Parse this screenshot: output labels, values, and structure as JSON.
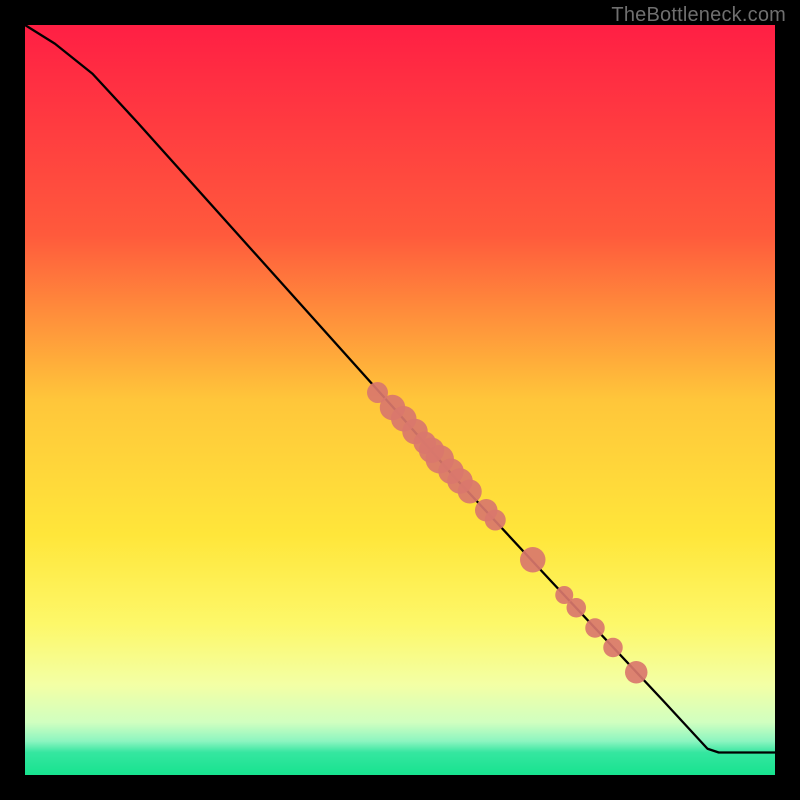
{
  "watermark": "TheBottleneck.com",
  "chart_data": {
    "type": "line",
    "title": "",
    "xlabel": "",
    "ylabel": "",
    "xlim": [
      0,
      100
    ],
    "ylim": [
      0,
      100
    ],
    "gradient_stops": [
      {
        "offset": 0,
        "color": "#ff1f44"
      },
      {
        "offset": 28,
        "color": "#ff5a3c"
      },
      {
        "offset": 50,
        "color": "#ffc63a"
      },
      {
        "offset": 68,
        "color": "#ffe63a"
      },
      {
        "offset": 80,
        "color": "#fdf86a"
      },
      {
        "offset": 88,
        "color": "#f3ffa5"
      },
      {
        "offset": 93,
        "color": "#d0ffc0"
      },
      {
        "offset": 95.5,
        "color": "#8cf5c0"
      },
      {
        "offset": 97,
        "color": "#35e6a0"
      },
      {
        "offset": 100,
        "color": "#17e38f"
      }
    ],
    "curve": [
      {
        "x": 0,
        "y": 100
      },
      {
        "x": 4,
        "y": 97.5
      },
      {
        "x": 9,
        "y": 93.5
      },
      {
        "x": 15,
        "y": 87
      },
      {
        "x": 50,
        "y": 48
      },
      {
        "x": 57,
        "y": 40
      },
      {
        "x": 70,
        "y": 26
      },
      {
        "x": 85,
        "y": 10
      },
      {
        "x": 91,
        "y": 3.5
      },
      {
        "x": 92.5,
        "y": 3
      },
      {
        "x": 100,
        "y": 3
      }
    ],
    "series": [
      {
        "name": "markers",
        "points": [
          {
            "x": 47,
            "y": 51,
            "r": 1.4
          },
          {
            "x": 49,
            "y": 49,
            "r": 1.7
          },
          {
            "x": 50.5,
            "y": 47.5,
            "r": 1.7
          },
          {
            "x": 52,
            "y": 45.8,
            "r": 1.7
          },
          {
            "x": 53.3,
            "y": 44.3,
            "r": 1.5
          },
          {
            "x": 54.2,
            "y": 43.3,
            "r": 1.7
          },
          {
            "x": 55.3,
            "y": 42.1,
            "r": 1.9
          },
          {
            "x": 56.8,
            "y": 40.5,
            "r": 1.7
          },
          {
            "x": 58,
            "y": 39.2,
            "r": 1.7
          },
          {
            "x": 59.3,
            "y": 37.8,
            "r": 1.6
          },
          {
            "x": 61.5,
            "y": 35.3,
            "r": 1.5
          },
          {
            "x": 62.7,
            "y": 34,
            "r": 1.4
          },
          {
            "x": 67.7,
            "y": 28.7,
            "r": 1.7
          },
          {
            "x": 71.9,
            "y": 24,
            "r": 1.2
          },
          {
            "x": 73.5,
            "y": 22.3,
            "r": 1.3
          },
          {
            "x": 76,
            "y": 19.6,
            "r": 1.3
          },
          {
            "x": 78.4,
            "y": 17,
            "r": 1.3
          },
          {
            "x": 81.5,
            "y": 13.7,
            "r": 1.5
          }
        ],
        "color": "#d9776c"
      }
    ]
  }
}
